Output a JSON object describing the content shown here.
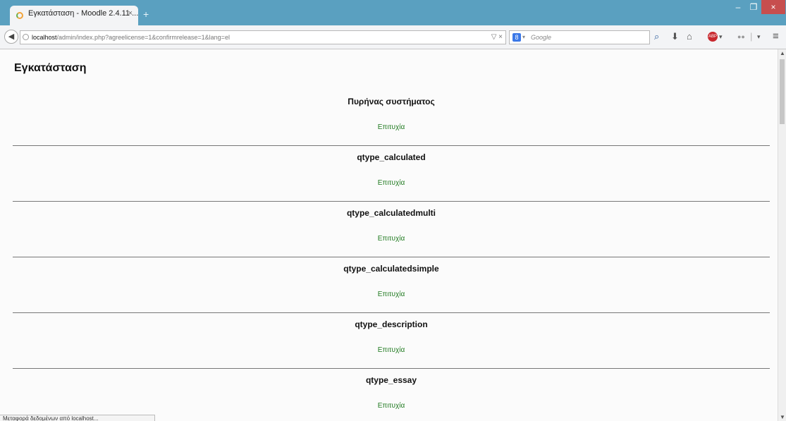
{
  "browser": {
    "tab_title": "Εγκατάσταση - Moodle 2.4.11 ...",
    "tab_close": "×",
    "new_tab": "+",
    "window_controls": {
      "minimize": "–",
      "maximize": "❐",
      "close": "×"
    },
    "url": {
      "host": "localhost",
      "path": "/admin/index.php?agreelicense=1&confirmrelease=1&lang=el",
      "tools": "▽ ×"
    },
    "search": {
      "engine_icon": "8",
      "placeholder": "Google"
    },
    "icons": [
      "back-icon",
      "globe-icon",
      "google-icon",
      "search-icon",
      "download-icon",
      "home-icon",
      "adblock-icon",
      "extension-icon",
      "menu-icon"
    ]
  },
  "page": {
    "title": "Εγκατάσταση",
    "sections": [
      {
        "heading": "Πυρήνας συστήματος",
        "status": "Επιτυχία"
      },
      {
        "heading": "qtype_calculated",
        "status": "Επιτυχία"
      },
      {
        "heading": "qtype_calculatedmulti",
        "status": "Επιτυχία"
      },
      {
        "heading": "qtype_calculatedsimple",
        "status": "Επιτυχία"
      },
      {
        "heading": "qtype_description",
        "status": "Επιτυχία"
      },
      {
        "heading": "qtype_essay",
        "status": "Επιτυχία"
      }
    ]
  },
  "status_bar": {
    "text": "Μεταφορά δεδομένων από localhost..."
  },
  "colors": {
    "title_bar": "#5aa0c0",
    "success_text": "#1f7a1f",
    "close_button": "#c74e4e"
  }
}
